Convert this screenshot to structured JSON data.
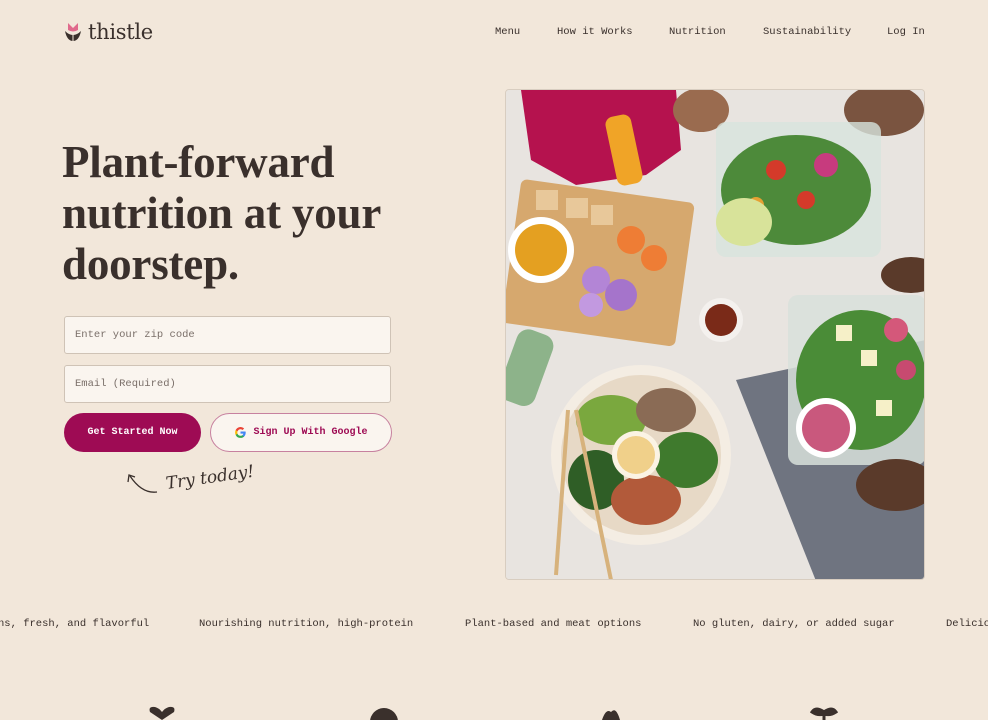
{
  "brand": {
    "name": "thistle",
    "accent": "#9e0b54",
    "logo_pink": "#e06a8c"
  },
  "nav": {
    "items": [
      "Menu",
      "How it Works",
      "Nutrition",
      "Sustainability",
      "Log In"
    ]
  },
  "hero": {
    "headline": "Plant-forward nutrition at your doorstep.",
    "zip_placeholder": "Enter your zip code",
    "email_placeholder": "Email (Required)",
    "cta_primary": "Get Started Now",
    "cta_google": "Sign Up With Google",
    "try_note": "Try today!"
  },
  "ticker": {
    "items": [
      "ns, fresh, and flavorful",
      "Nourishing nutrition, high-protein",
      "Plant-based and meat options",
      "No gluten, dairy, or added sugar",
      "Delicio"
    ]
  },
  "features": {
    "icons": [
      "heart-icon",
      "sun-icon",
      "leaf-bunch-icon",
      "plant-icon"
    ]
  }
}
